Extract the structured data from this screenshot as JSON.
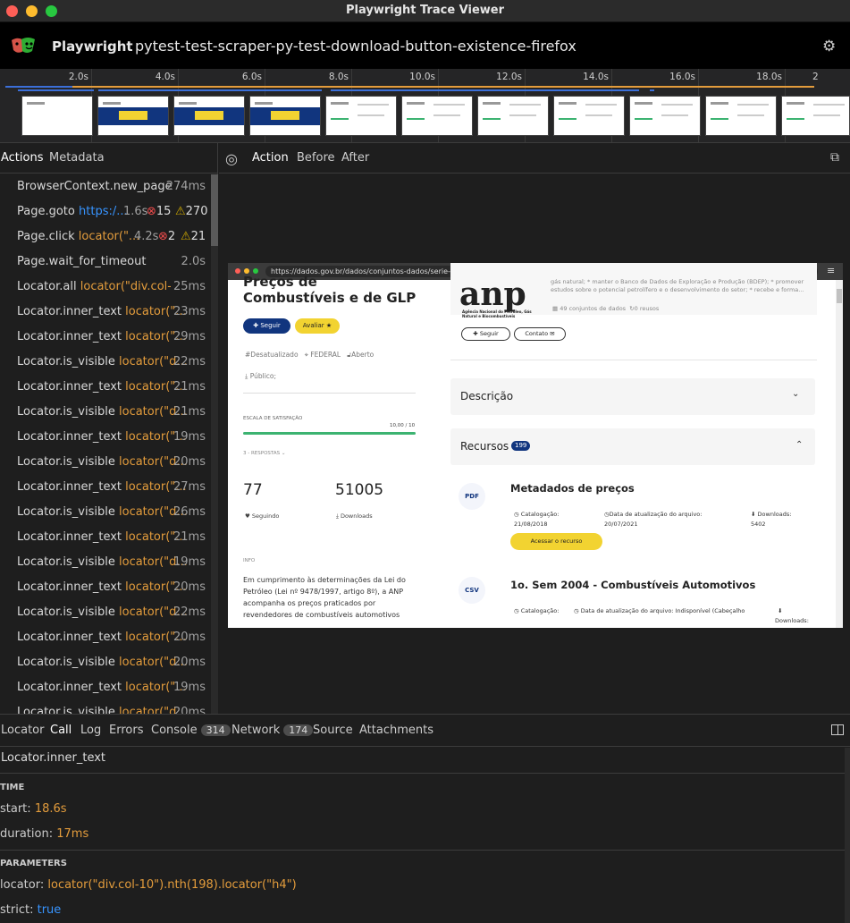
{
  "window": {
    "title": "Playwright Trace Viewer"
  },
  "header": {
    "brand": "Playwright",
    "trace_name": "pytest-test-scraper-py-test-download-button-existence-firefox"
  },
  "timeline": {
    "ticks": [
      "2.0s",
      "4.0s",
      "6.0s",
      "8.0s",
      "10.0s",
      "12.0s",
      "14.0s",
      "16.0s",
      "18.0s",
      "2"
    ]
  },
  "left_tabs": {
    "actions": "Actions",
    "metadata": "Metadata"
  },
  "actions": [
    {
      "name": "BrowserContext.new_page",
      "arg": "",
      "duration": "274ms"
    },
    {
      "name": "Page.goto",
      "arg": "https:/...",
      "arg_type": "url",
      "duration": "1.6s",
      "errors": "15",
      "warnings": "270"
    },
    {
      "name": "Page.click",
      "arg": "locator(\"...",
      "duration": "4.2s",
      "errors": "2",
      "warnings": "21"
    },
    {
      "name": "Page.wait_for_timeout",
      "arg": "",
      "duration": "2.0s"
    },
    {
      "name": "Locator.all",
      "arg": "locator(\"div.col-1...",
      "duration": "25ms"
    },
    {
      "name": "Locator.inner_text",
      "arg": "locator(\"...",
      "duration": "23ms"
    },
    {
      "name": "Locator.inner_text",
      "arg": "locator(\"...",
      "duration": "29ms"
    },
    {
      "name": "Locator.is_visible",
      "arg": "locator(\"d...",
      "duration": "22ms"
    },
    {
      "name": "Locator.inner_text",
      "arg": "locator(\"...",
      "duration": "21ms"
    },
    {
      "name": "Locator.is_visible",
      "arg": "locator(\"d...",
      "duration": "21ms"
    },
    {
      "name": "Locator.inner_text",
      "arg": "locator(\"...",
      "duration": "19ms"
    },
    {
      "name": "Locator.is_visible",
      "arg": "locator(\"d...",
      "duration": "20ms"
    },
    {
      "name": "Locator.inner_text",
      "arg": "locator(\"...",
      "duration": "27ms"
    },
    {
      "name": "Locator.is_visible",
      "arg": "locator(\"d...",
      "duration": "26ms"
    },
    {
      "name": "Locator.inner_text",
      "arg": "locator(\"...",
      "duration": "21ms"
    },
    {
      "name": "Locator.is_visible",
      "arg": "locator(\"d...",
      "duration": "19ms"
    },
    {
      "name": "Locator.inner_text",
      "arg": "locator(\"...",
      "duration": "20ms"
    },
    {
      "name": "Locator.is_visible",
      "arg": "locator(\"d...",
      "duration": "22ms"
    },
    {
      "name": "Locator.inner_text",
      "arg": "locator(\"...",
      "duration": "20ms"
    },
    {
      "name": "Locator.is_visible",
      "arg": "locator(\"d...",
      "duration": "20ms"
    },
    {
      "name": "Locator.inner_text",
      "arg": "locator(\"...",
      "duration": "19ms"
    },
    {
      "name": "Locator.is_visible",
      "arg": "locator(\"d...",
      "duration": "20ms"
    }
  ],
  "snapshot_tabs": {
    "action": "Action",
    "before": "Before",
    "after": "After"
  },
  "snapshot": {
    "url": "https://dados.gov.br/dados/conjuntos-dados/serie-historica-de-precos-de-combustiveis-e-de-glp",
    "title": "Preços de Combustíveis e de GLP",
    "follow": "Seguir",
    "rate": "Avaliar",
    "meta_outdated": "Desatualizado",
    "meta_federal": "FEDERAL",
    "meta_open": "Aberto",
    "meta_public": "Público;",
    "satisfaction_label": "ESCALA DE SATISFAÇÃO",
    "satisfaction_value": "10,00 / 10",
    "satisfaction_level": 1.0,
    "responses": "3 - RESPOSTAS",
    "followers_count": "77",
    "followers_label": "Seguindo",
    "downloads_count": "51005",
    "downloads_label": "Downloads",
    "info_label": "INFO",
    "info_text": "Em cumprimento às determinações da Lei do Petróleo (Lei nº 9478/1997, artigo 8º), a ANP acompanha os preços praticados por revendedores de combustíveis automotivos",
    "org_text": "gás natural; * manter o Banco de Dados de Exploração e Produção (BDEP); * promover estudos sobre o potencial petrolífero e o desenvolvimento do setor; * recebe e forma...",
    "org_logo": "anp",
    "org_subtitle": "Agência Nacional do Petróleo, Gás Natural e Biocombustíveis",
    "org_datasets": "49 conjuntos de dados",
    "org_reuses": "0 reusos",
    "org_follow": "Seguir",
    "org_contact": "Contato",
    "description": "Descrição",
    "resources": "Recursos",
    "resources_count": "199",
    "res1_format": "PDF",
    "res1_title": "Metadados de preços",
    "res1_cat_label": "Catalogação:",
    "res1_cat_date": "21/08/2018",
    "res1_upd_label": "Data de atualização do arquivo:",
    "res1_upd_date": "20/07/2021",
    "res1_dl_label": "Downloads:",
    "res1_dl_count": "5402",
    "res1_access": "Acessar o recurso",
    "res2_format": "CSV",
    "res2_title": "1o. Sem 2004 - Combustíveis Automotivos",
    "res2_cat_label": "Catalogação:",
    "res2_upd_label": "Data de atualização do arquivo: Indisponível (Cabeçalho",
    "res2_dl_label": "Downloads:"
  },
  "bottom_tabs": {
    "locator": "Locator",
    "call": "Call",
    "log": "Log",
    "errors": "Errors",
    "console": "Console",
    "console_count": "314",
    "network": "Network",
    "network_count": "174",
    "source": "Source",
    "attachments": "Attachments"
  },
  "details": {
    "action_name": "Locator.inner_text",
    "time_header": "TIME",
    "start_label": "start:",
    "start_value": "18.6s",
    "duration_label": "duration:",
    "duration_value": "17ms",
    "params_header": "PARAMETERS",
    "locator_label": "locator:",
    "locator_value": "locator(\"div.col-10\").nth(198).locator(\"h4\")",
    "strict_label": "strict:",
    "strict_value": "true"
  },
  "colors": {
    "accent": "#e39c3c",
    "link": "#3794ff",
    "brand_blue": "#11357e",
    "yellow": "#f2d331",
    "green": "#3cb371"
  }
}
